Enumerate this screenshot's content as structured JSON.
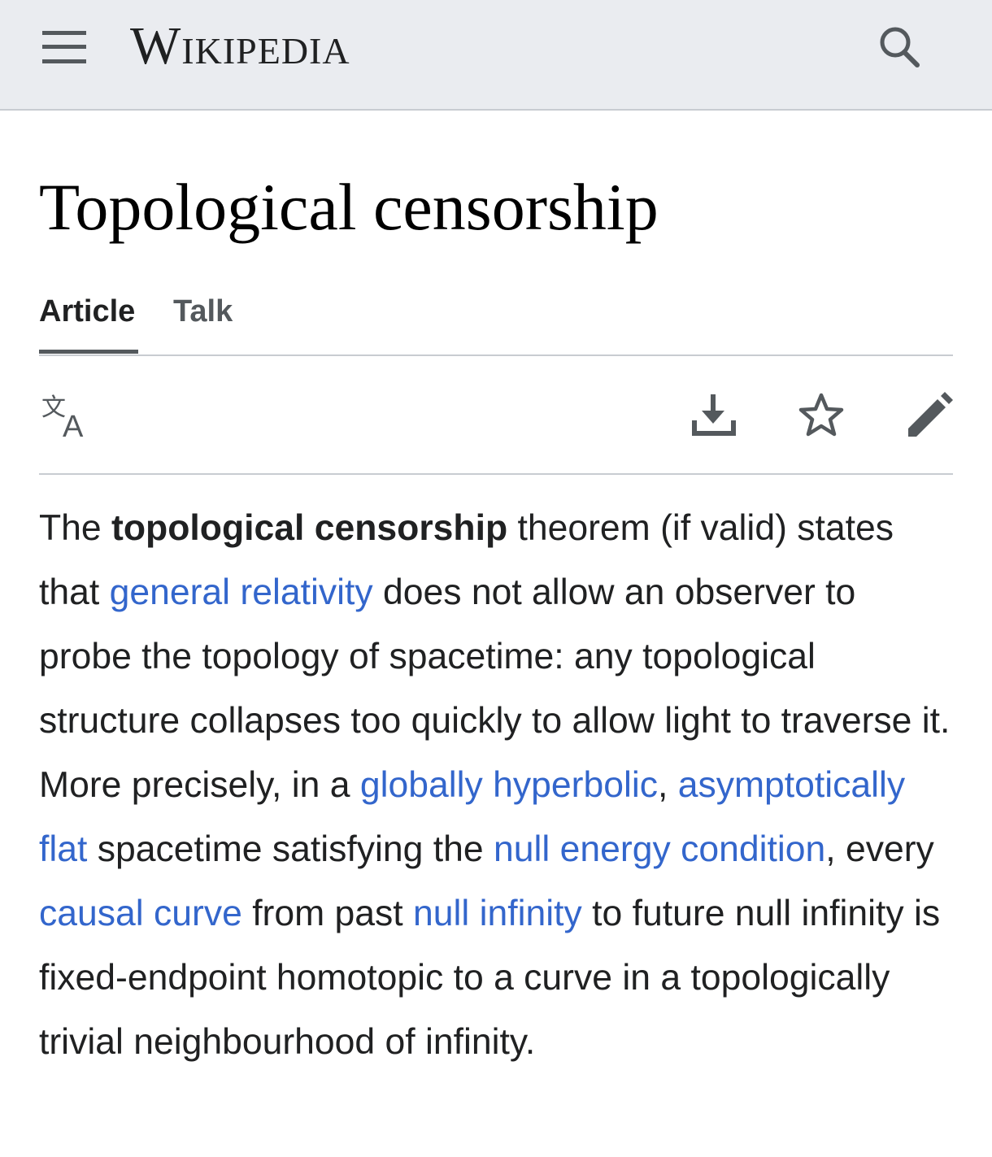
{
  "header": {
    "menu_icon": "hamburger-menu-icon",
    "wordmark": "Wikipedia",
    "search_icon": "search-icon"
  },
  "page": {
    "title": "Topological censorship"
  },
  "tabs": [
    {
      "label": "Article",
      "active": true
    },
    {
      "label": "Talk",
      "active": false
    }
  ],
  "toolbar": {
    "language_icon": "language-icon",
    "download_icon": "download-icon",
    "watch_icon": "star-icon",
    "edit_icon": "pencil-icon"
  },
  "article": {
    "segments": [
      {
        "t": "The ",
        "kind": "text"
      },
      {
        "t": "topological censorship",
        "kind": "bold"
      },
      {
        "t": " theorem (if valid) states that ",
        "kind": "text"
      },
      {
        "t": "general relativity",
        "kind": "link"
      },
      {
        "t": " does not allow an observer to probe the topology of spacetime: any topological structure collapses too quickly to allow light to traverse it. More precisely, in a ",
        "kind": "text"
      },
      {
        "t": "globally hyperbolic",
        "kind": "link"
      },
      {
        "t": ", ",
        "kind": "text"
      },
      {
        "t": "asymptotically flat",
        "kind": "link"
      },
      {
        "t": " spacetime satisfying the ",
        "kind": "text"
      },
      {
        "t": "null energy condition",
        "kind": "link"
      },
      {
        "t": ", every ",
        "kind": "text"
      },
      {
        "t": "causal curve",
        "kind": "link"
      },
      {
        "t": " from past ",
        "kind": "text"
      },
      {
        "t": "null infinity",
        "kind": "link"
      },
      {
        "t": " to future null infinity is fixed-endpoint homotopic to a curve in a topologically trivial neighbourhood of infinity.",
        "kind": "text"
      }
    ]
  },
  "colors": {
    "header_bg": "#eaecf0",
    "link": "#3366cc",
    "text": "#202122",
    "divider": "#c8ccd1"
  }
}
